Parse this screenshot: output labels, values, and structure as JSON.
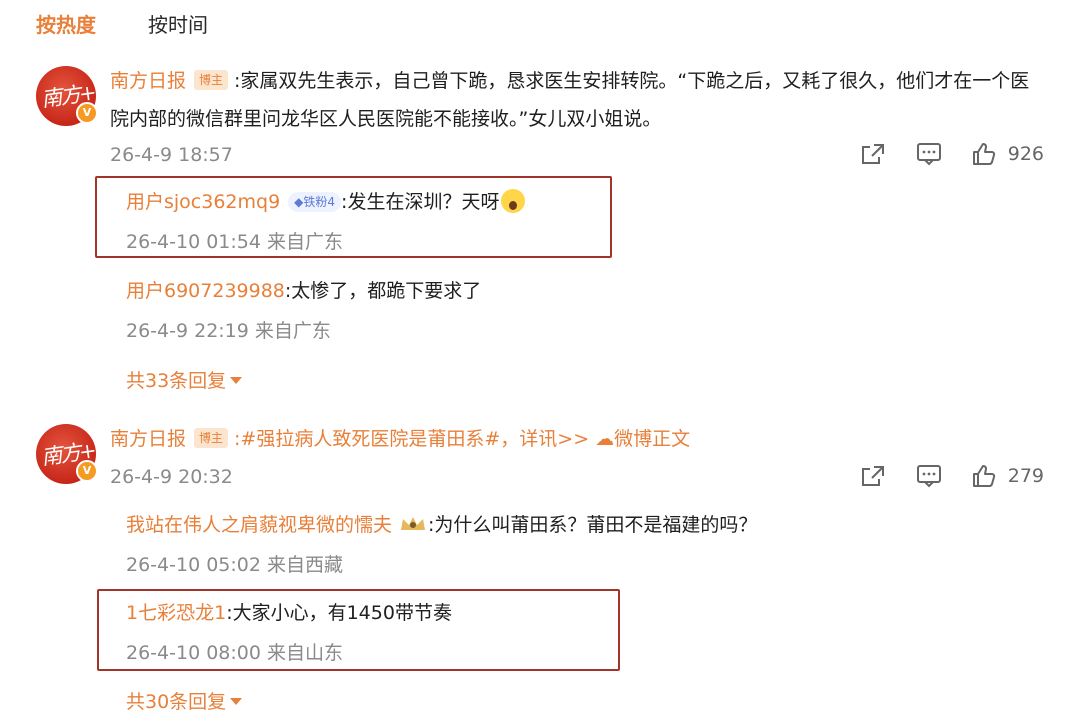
{
  "tabs": [
    {
      "label": "按热度",
      "active": true
    },
    {
      "label": "按时间",
      "active": false
    }
  ],
  "colors": {
    "accent": "#e8803a",
    "muted": "#8a8a8a",
    "highlight_box": "#a3342a"
  },
  "comments": [
    {
      "author": "南方日报",
      "badge": "博主",
      "text": ":家属双先生表示，自己曾下跪，恳求医生安排转院。“下跪之后，又耗了很久，他们才在一个医院内部的微信群里问龙华区人民医院能不能接收。”女儿双小姐说。",
      "time": "26-4-9 18:57",
      "likes": "926",
      "replies": [
        {
          "author": "用户sjoc362mq9",
          "badge": "铁粉4",
          "text": ":发生在深圳？天呀",
          "emoji": "scream-emoji",
          "meta": "26-4-10 01:54 来自广东",
          "highlighted": true
        },
        {
          "author": "用户6907239988",
          "text": ":太惨了，都跪下要求了",
          "meta": "26-4-9 22:19 来自广东",
          "highlighted": false
        }
      ],
      "more_label": "共33条回复"
    },
    {
      "author": "南方日报",
      "badge": "博主",
      "text": ":#强拉病人致死医院是莆田系#，详讯>>",
      "link": "微博正文",
      "time": "26-4-9 20:32",
      "likes": "279",
      "replies": [
        {
          "author": "我站在伟人之肩藐视卑微的懦夫",
          "text": ":为什么叫莆田系？莆田不是福建的吗？",
          "meta": "26-4-10 05:02 来自西藏",
          "highlighted": false
        },
        {
          "author": "1七彩恐龙1",
          "text": ":大家小心，有1450带节奏",
          "meta": "26-4-10 08:00 来自山东",
          "highlighted": true
        }
      ],
      "more_label": "共30条回复"
    }
  ]
}
